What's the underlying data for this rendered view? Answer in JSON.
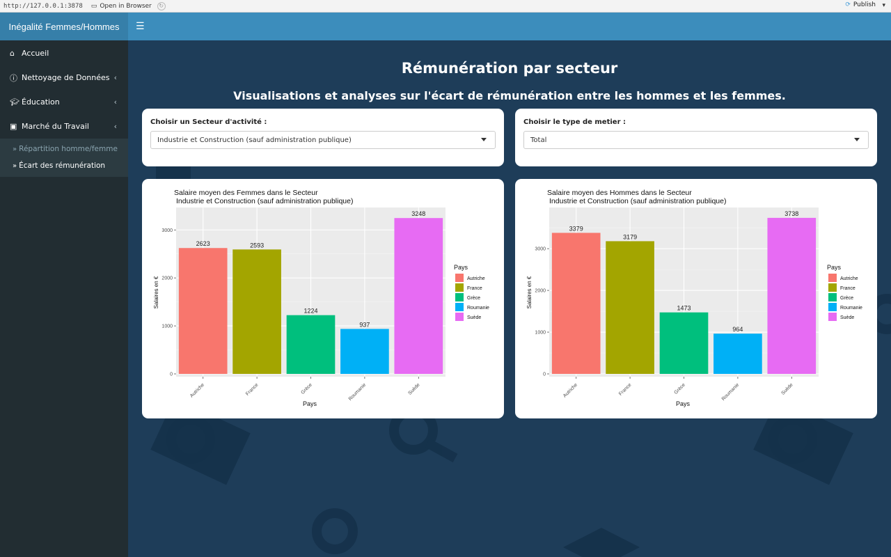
{
  "browser": {
    "url": "http://127.0.0.1:3878",
    "open_browser": "Open in Browser",
    "publish": "Publish"
  },
  "app": {
    "title": "Inégalité Femmes/Hommes"
  },
  "sidebar": {
    "items": [
      {
        "label": "Accueil",
        "icon": "home-icon"
      },
      {
        "label": "Nettoyage de Données",
        "icon": "info-icon"
      },
      {
        "label": "Éducation",
        "icon": "graduation-cap-icon"
      },
      {
        "label": "Marché du Travail",
        "icon": "briefcase-icon"
      }
    ],
    "sub_items": [
      {
        "label": "Répartition homme/femme",
        "active": false
      },
      {
        "label": "Écart des rémunération",
        "active": true
      }
    ]
  },
  "main": {
    "title": "Rémunération par secteur",
    "subtitle": "Visualisations et analyses sur l'écart de rémunération entre les hommes et les femmes.",
    "select_sector": {
      "label": "Choisir un Secteur d'activité :",
      "value": "Industrie et Construction (sauf administration publique)"
    },
    "select_type": {
      "label": "Choisir le type de metier :",
      "value": "Total"
    }
  },
  "colors": {
    "Autriche": "#f8766d",
    "France": "#a3a500",
    "Grèce": "#00bf7d",
    "Roumanie": "#00b0f6",
    "Suède": "#e76bf3"
  },
  "chart_data": [
    {
      "type": "bar",
      "title": "Salaire moyen des Femmes dans le Secteur",
      "subtitle": "Industrie et Construction (sauf administration publique)",
      "xlabel": "Pays",
      "ylabel": "Salaires en €",
      "categories": [
        "Autriche",
        "France",
        "Grèce",
        "Roumanie",
        "Suède"
      ],
      "values": [
        2623,
        2593,
        1224,
        937,
        3248
      ],
      "yticks": [
        0,
        1000,
        2000,
        3000
      ],
      "ylim": [
        0,
        3410
      ],
      "legend_title": "Pays",
      "legend_placement": "right",
      "grid": true
    },
    {
      "type": "bar",
      "title": "Salaire moyen des Hommes dans le Secteur",
      "subtitle": "Industrie et Construction (sauf administration publique)",
      "xlabel": "Pays",
      "ylabel": "Salaires en €",
      "categories": [
        "Autriche",
        "France",
        "Grèce",
        "Roumanie",
        "Suède"
      ],
      "values": [
        3379,
        3179,
        1473,
        964,
        3738
      ],
      "yticks": [
        0,
        1000,
        2000,
        3000
      ],
      "ylim": [
        0,
        3920
      ],
      "legend_title": "Pays",
      "legend_placement": "right",
      "grid": true
    }
  ]
}
